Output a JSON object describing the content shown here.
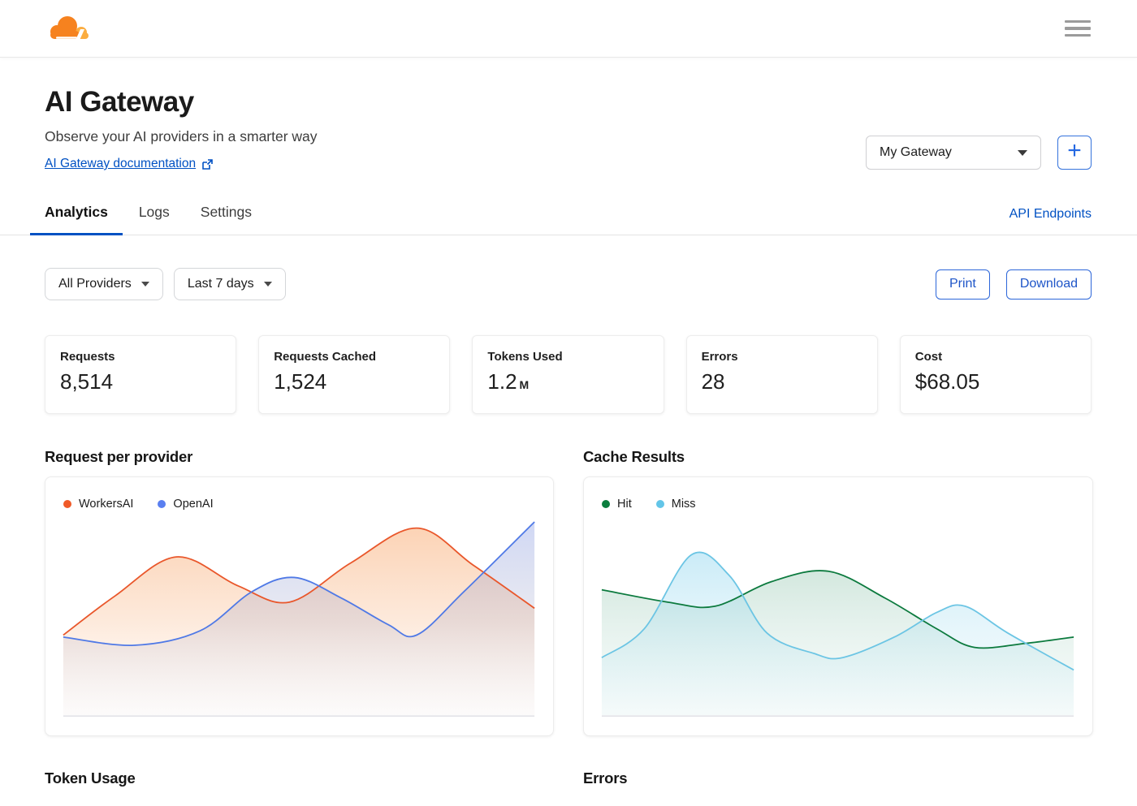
{
  "colors": {
    "accent_link": "#0051c3",
    "button_blue": "#2c66d9",
    "cloudflare_orange": "#f6821f",
    "cloudflare_light_orange": "#fbad41"
  },
  "header": {
    "logo": "cloudflare-logo",
    "menu_icon": "hamburger-menu"
  },
  "page": {
    "title": "AI Gateway",
    "subtitle": "Observe your AI providers in a smarter way",
    "doc_link_label": "AI Gateway documentation",
    "gateway_select_value": "My Gateway",
    "add_gateway_label": "+"
  },
  "tabs": {
    "items": [
      {
        "label": "Analytics",
        "active": true
      },
      {
        "label": "Logs",
        "active": false
      },
      {
        "label": "Settings",
        "active": false
      }
    ],
    "right_link": "API Endpoints"
  },
  "filters": {
    "provider_value": "All Providers",
    "range_value": "Last 7 days",
    "print_label": "Print",
    "download_label": "Download"
  },
  "stats": [
    {
      "label": "Requests",
      "value": "8,514",
      "suffix": ""
    },
    {
      "label": "Requests Cached",
      "value": "1,524",
      "suffix": ""
    },
    {
      "label": "Tokens Used",
      "value": "1.2",
      "suffix": "M"
    },
    {
      "label": "Errors",
      "value": "28",
      "suffix": ""
    },
    {
      "label": "Cost",
      "value": "$68.05",
      "suffix": ""
    }
  ],
  "sections": {
    "chart1_title": "Request per provider",
    "chart2_title": "Cache Results",
    "bottom1_title": "Token Usage",
    "bottom2_title": "Errors"
  },
  "chart_data": [
    {
      "type": "area",
      "title": "Request per provider",
      "x_axis": "hidden (7-day window implied by Last 7 days filter)",
      "y_axis": "hidden",
      "units": "relative 0-100",
      "legend_position": "top-left inside plot",
      "series": [
        {
          "name": "WorkersAI",
          "stroke": "#e9572b",
          "dot": "#f05a28",
          "fill_top": "rgba(246,138,59,0.42)",
          "fill_mid": "rgba(246,150,80,0.20)",
          "fill_bottom": "rgba(250,200,160,0.03)",
          "points": [
            [
              0,
              39
            ],
            [
              11,
              58
            ],
            [
              24,
              77
            ],
            [
              37,
              63
            ],
            [
              48,
              55
            ],
            [
              61,
              74
            ],
            [
              75,
              91
            ],
            [
              87,
              73
            ],
            [
              100,
              52
            ]
          ]
        },
        {
          "name": "OpenAI",
          "stroke": "#4f79e6",
          "dot": "#5a7ff0",
          "fill_top": "rgba(108,134,228,0.35)",
          "fill_mid": "rgba(148,152,190,0.20)",
          "fill_bottom": "rgba(205,205,225,0.05)",
          "points": [
            [
              0,
              38
            ],
            [
              15,
              34
            ],
            [
              29,
              41
            ],
            [
              40,
              60
            ],
            [
              49,
              67
            ],
            [
              59,
              57
            ],
            [
              69,
              44
            ],
            [
              75,
              39
            ],
            [
              85,
              60
            ],
            [
              100,
              94
            ]
          ]
        }
      ]
    },
    {
      "type": "area",
      "title": "Cache Results",
      "x_axis": "hidden (7-day window implied by Last 7 days filter)",
      "y_axis": "hidden",
      "units": "relative 0-100",
      "legend_position": "top-left inside plot",
      "series": [
        {
          "name": "Hit",
          "stroke": "#0c7a3e",
          "dot": "#0b7e3e",
          "fill_top": "rgba(23,128,69,0.30)",
          "fill_mid": "rgba(90,170,140,0.16)",
          "fill_bottom": "rgba(140,200,180,0.05)",
          "points": [
            [
              0,
              61
            ],
            [
              14,
              55
            ],
            [
              24,
              53
            ],
            [
              36,
              65
            ],
            [
              48,
              70
            ],
            [
              60,
              57
            ],
            [
              71,
              42
            ],
            [
              79,
              33
            ],
            [
              90,
              35
            ],
            [
              100,
              38
            ]
          ]
        },
        {
          "name": "Miss",
          "stroke": "#6cc5e4",
          "dot": "#63c5e8",
          "fill_top": "rgba(125,208,238,0.55)",
          "fill_mid": "rgba(150,215,238,0.25)",
          "fill_bottom": "rgba(175,222,238,0.06)",
          "points": [
            [
              0,
              28
            ],
            [
              9,
              42
            ],
            [
              19,
              78
            ],
            [
              27,
              68
            ],
            [
              35,
              40
            ],
            [
              45,
              30
            ],
            [
              51,
              28
            ],
            [
              62,
              38
            ],
            [
              71,
              50
            ],
            [
              77,
              53
            ],
            [
              86,
              40
            ],
            [
              100,
              22
            ]
          ]
        }
      ]
    }
  ]
}
